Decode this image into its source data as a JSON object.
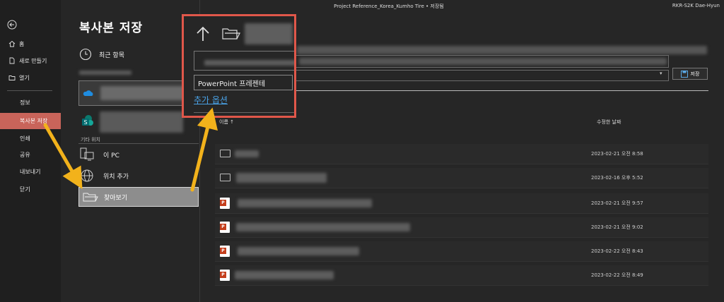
{
  "window": {
    "title": "Project Reference_Korea_Kumho Tire • 저장됨",
    "user": "RKR-S2K Dae-Hyun"
  },
  "nav": {
    "back_icon": "back-arrow-icon",
    "items": [
      {
        "label": "홈",
        "icon": "home-icon"
      },
      {
        "label": "새로 만들기",
        "icon": "new-file-icon"
      },
      {
        "label": "열기",
        "icon": "open-folder-icon"
      },
      {
        "label": "정보"
      },
      {
        "label": "복사본 저장",
        "active": true
      },
      {
        "label": "인쇄"
      },
      {
        "label": "공유"
      },
      {
        "label": "내보내기"
      },
      {
        "label": "닫기"
      }
    ]
  },
  "page_title": "복사본 저장",
  "locations": {
    "recent": "최근 항목",
    "other_section": "기타 위치",
    "this_pc": "이 PC",
    "add_place": "위치 추가",
    "browse": "찾아보기"
  },
  "save": {
    "button_label": "저장",
    "dropdown_icon": "chevron-down-icon"
  },
  "callout": {
    "file_type": "PowerPoint 프레젠테",
    "more_options": "추가 옵션"
  },
  "file_list": {
    "col_name": "이름 ↑",
    "col_date": "수정한 날짜",
    "rows": [
      {
        "type": "folder",
        "date": "2023-02-21 오전 8:58"
      },
      {
        "type": "folder",
        "date": "2023-02-16 오후 5:52"
      },
      {
        "type": "ppt",
        "date": "2023-02-21 오전 9:57"
      },
      {
        "type": "ppt",
        "date": "2023-02-21 오전 9:02"
      },
      {
        "type": "ppt",
        "date": "2023-02-22 오전 8:43"
      },
      {
        "type": "ppt",
        "date": "2023-02-22 오전 8:49"
      }
    ]
  },
  "colors": {
    "accent": "#c9645a",
    "callout_border": "#e0574a",
    "arrow": "#f2b21b",
    "link": "#4aa3e8"
  }
}
